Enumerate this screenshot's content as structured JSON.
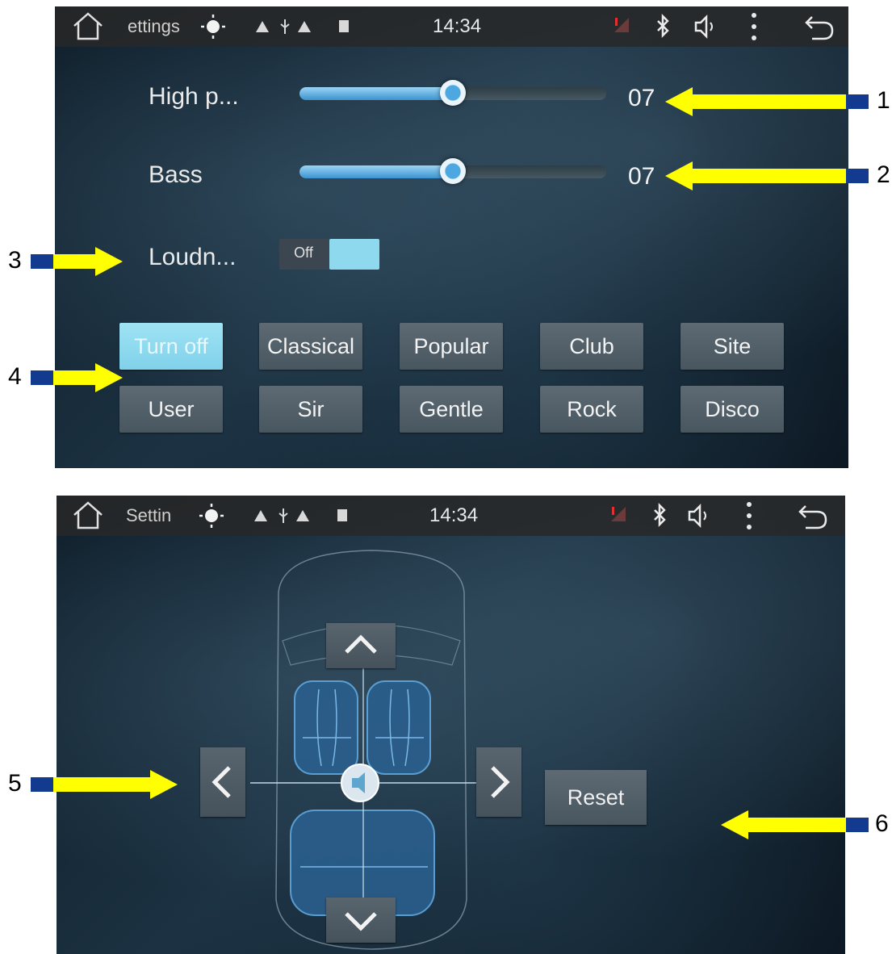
{
  "screen1": {
    "statusbar": {
      "app_title": "ettings",
      "clock": "14:34"
    },
    "sliders": [
      {
        "label": "High p...",
        "value_text": "07",
        "level": 0.5
      },
      {
        "label": "Bass",
        "value_text": "07",
        "level": 0.5
      }
    ],
    "loudness": {
      "label": "Loudn...",
      "state_text": "Off"
    },
    "presets_row1": [
      "Turn off",
      "Classical",
      "Popular",
      "Club",
      "Site"
    ],
    "presets_row2": [
      "User",
      "Sir",
      "Gentle",
      "Rock",
      "Disco"
    ],
    "active_preset": "Turn off"
  },
  "screen2": {
    "statusbar": {
      "app_title": "Settin",
      "clock": "14:34"
    },
    "reset_label": "Reset"
  },
  "callouts": [
    "1",
    "2",
    "3",
    "4",
    "5",
    "6"
  ],
  "colors": {
    "callout_arrow": "#ffff00",
    "callout_square": "#123a8e",
    "slider_fill": "#4aa2da",
    "active_button": "#8fd9ee"
  },
  "icons": [
    "home-icon",
    "brightness-icon",
    "warning-icon",
    "usb-icon",
    "sd-card-icon",
    "signal-icon",
    "bluetooth-icon",
    "volume-icon",
    "more-vert-icon",
    "back-icon"
  ]
}
